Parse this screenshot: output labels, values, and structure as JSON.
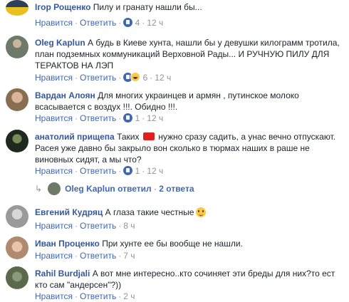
{
  "actions": {
    "like": "Нравится",
    "reply": "Ответить"
  },
  "comments": [
    {
      "author": "Ігор Рощенко",
      "text": "Пилу и гранату нашли бы...",
      "reactions": "4",
      "time": "12 ч",
      "avatar_color": "#2d3f5a"
    },
    {
      "author": "Oleg Kaplun",
      "text": "А будь в Киеве хунта, нашли бы у девушки килограмм тротила, план подземных коммуникаций Верховной Рады... И РУЧНУЮ ПИЛУ ДЛЯ ТЕРАКТОВ НА ЛЭП",
      "reactions": "6",
      "time": "12 ч",
      "avatar_color": "#6d7a6a"
    },
    {
      "author": "Вардан Алоян",
      "text": "Для многих украинцев и армян , путинское молоко всасывается с воздух !!!. Обидно !!!.",
      "reactions": "1",
      "time": "12 ч",
      "avatar_color": "#8a6e52"
    },
    {
      "author": "анатолий прищепа",
      "text_before": "Таких",
      "text_after": "нужно сразу садить, а унас вечно отпускают. Расея уже давно бы закрыло вон сколько в тюрмах наших в раше не виновных сидят, а мы что?",
      "reactions": "1",
      "time": "12 ч",
      "avatar_color": "#1f2a1f"
    },
    {
      "author": "Евгений Кудряц",
      "text": "А глаза такие честные",
      "time": "8 ч",
      "avatar_color": "#9a9a9a"
    },
    {
      "author": "Иван Проценко",
      "text": "При хунте ее бы вообще не нашли.",
      "time": "7 ч",
      "avatar_color": "#b08a6e"
    },
    {
      "author": "Rahil Burdjali",
      "text": "А вот мне интересно..кто сочиняет эти бреды для них?то ест кто сам \"андерсен\"?))",
      "time": "2 ч",
      "avatar_color": "#5a6a4a"
    }
  ],
  "replies_summary": {
    "arrow": "↳",
    "author": "Oleg Kaplun",
    "verb": "ответил",
    "sep": "·",
    "count": "2 ответа",
    "avatar_color": "#6d7a6a"
  },
  "colors": {
    "link": "#365899",
    "action": "#4267b2",
    "meta": "#90949c"
  }
}
